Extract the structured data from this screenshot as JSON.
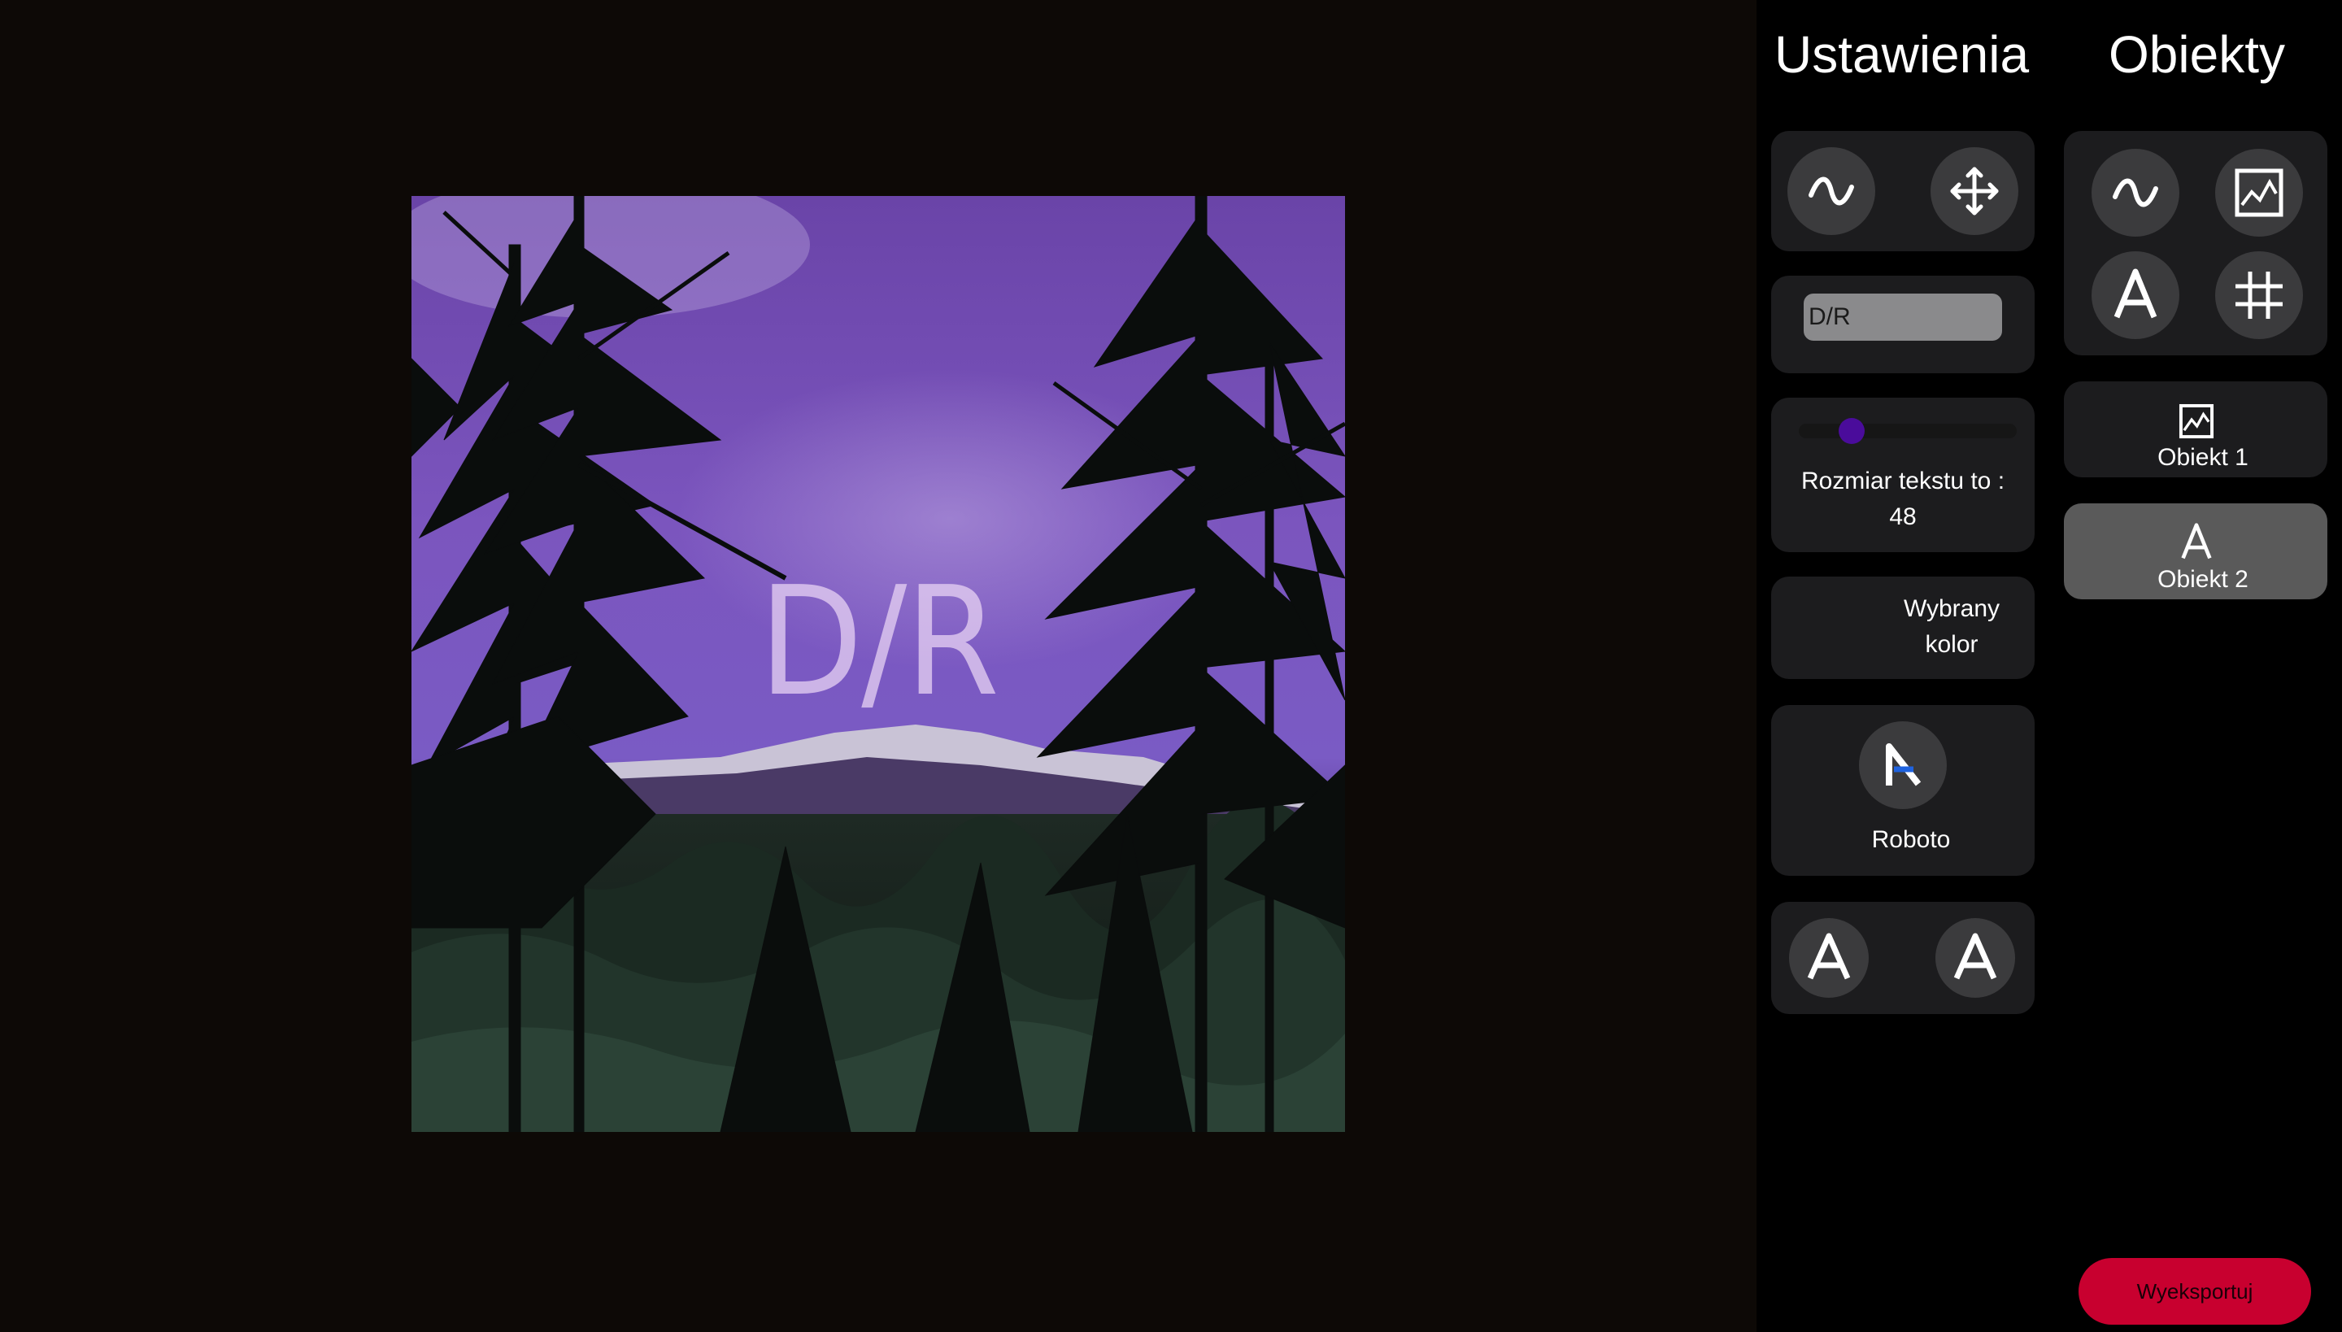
{
  "canvas": {
    "overlay_text": "D/R"
  },
  "panel": {
    "settings_heading": "Ustawienia",
    "objects_heading": "Obiekty",
    "text_input_value": "D/R",
    "slider_value": 48,
    "text_size_label": "Rozmiar tekstu to :",
    "text_size_value": "48",
    "selected_color_label_1": "Wybrany",
    "selected_color_label_2": "kolor",
    "font_name": "Roboto",
    "objects": [
      {
        "label": "Obiekt 1",
        "icon": "image-icon",
        "selected": false
      },
      {
        "label": "Obiekt 2",
        "icon": "text-icon",
        "selected": true
      }
    ],
    "export_label": "Wyeksportuj"
  },
  "colors": {
    "background": "#0d0906",
    "panel": "#000000",
    "card": "#1c1c1e",
    "circle": "#3b3b3d",
    "selected_object": "#5a5a5a",
    "slider_thumb": "#4a0c9b",
    "export_button": "#c8002f",
    "accent_blue": "#1f63e0"
  }
}
